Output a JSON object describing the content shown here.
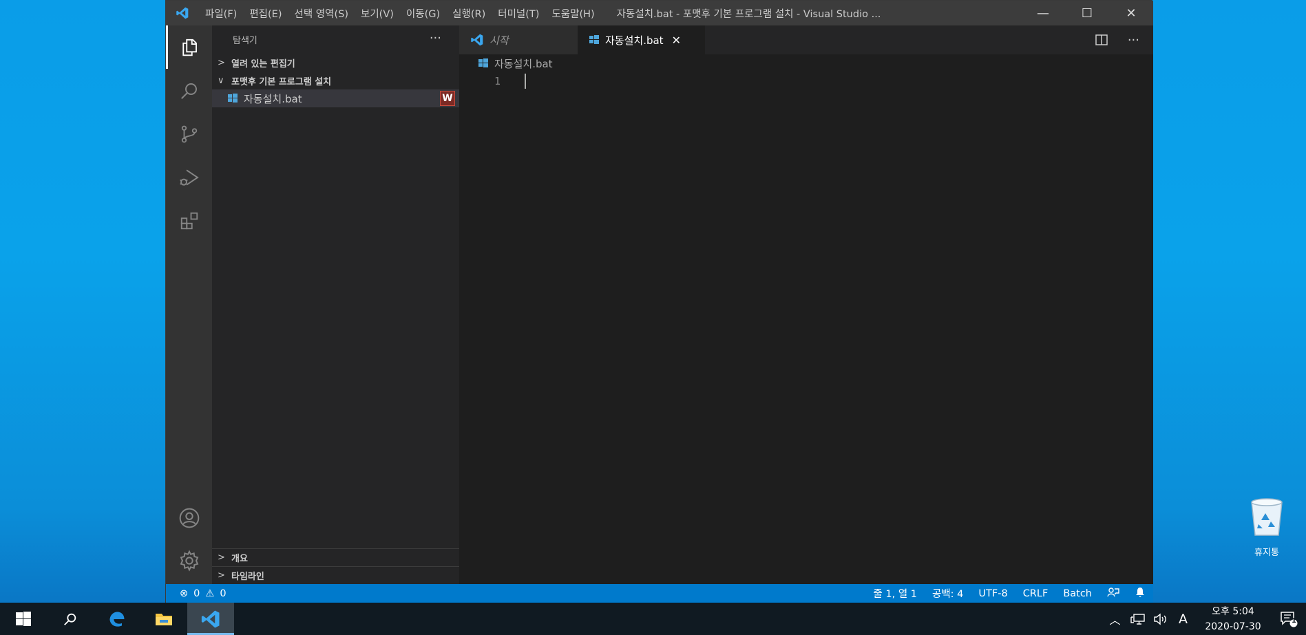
{
  "window": {
    "menu": [
      "파일(F)",
      "편집(E)",
      "선택 영역(S)",
      "보기(V)",
      "이동(G)",
      "실행(R)",
      "터미널(T)",
      "도움말(H)"
    ],
    "title": "자동설치.bat - 포맷후 기본 프로그램 설치 - Visual Studio ...",
    "minimize": "—",
    "maximize": "☐",
    "close": "✕"
  },
  "sidebar": {
    "title": "탐색기",
    "more": "···",
    "open_editors": "열려 있는 편집기",
    "folder": "포맷후 기본 프로그램 설치",
    "file": "자동설치.bat",
    "file_badge": "W",
    "outline": "개요",
    "timeline": "타임라인"
  },
  "editor": {
    "tabs": [
      {
        "label": "시작",
        "active": false
      },
      {
        "label": "자동설치.bat",
        "active": true,
        "close": "✕"
      }
    ],
    "more": "···",
    "breadcrumb": "자동설치.bat",
    "line_number": "1"
  },
  "statusbar": {
    "errors": "0",
    "warnings": "0",
    "position": "줄 1, 열 1",
    "spaces": "공백: 4",
    "encoding": "UTF-8",
    "eol": "CRLF",
    "language": "Batch"
  },
  "desktop": {
    "recycle_bin": "휴지통"
  },
  "taskbar": {
    "tray_chevron": "︿",
    "ime": "A",
    "time": "오후 5:04",
    "date": "2020-07-30",
    "notif_count": "1"
  },
  "colors": {
    "titlebar": "#3c3c3c",
    "activity_bar": "#333333",
    "sidebar": "#252526",
    "editor": "#1e1e1e",
    "statusbar": "#007acc",
    "badge": "#7b2a24"
  }
}
